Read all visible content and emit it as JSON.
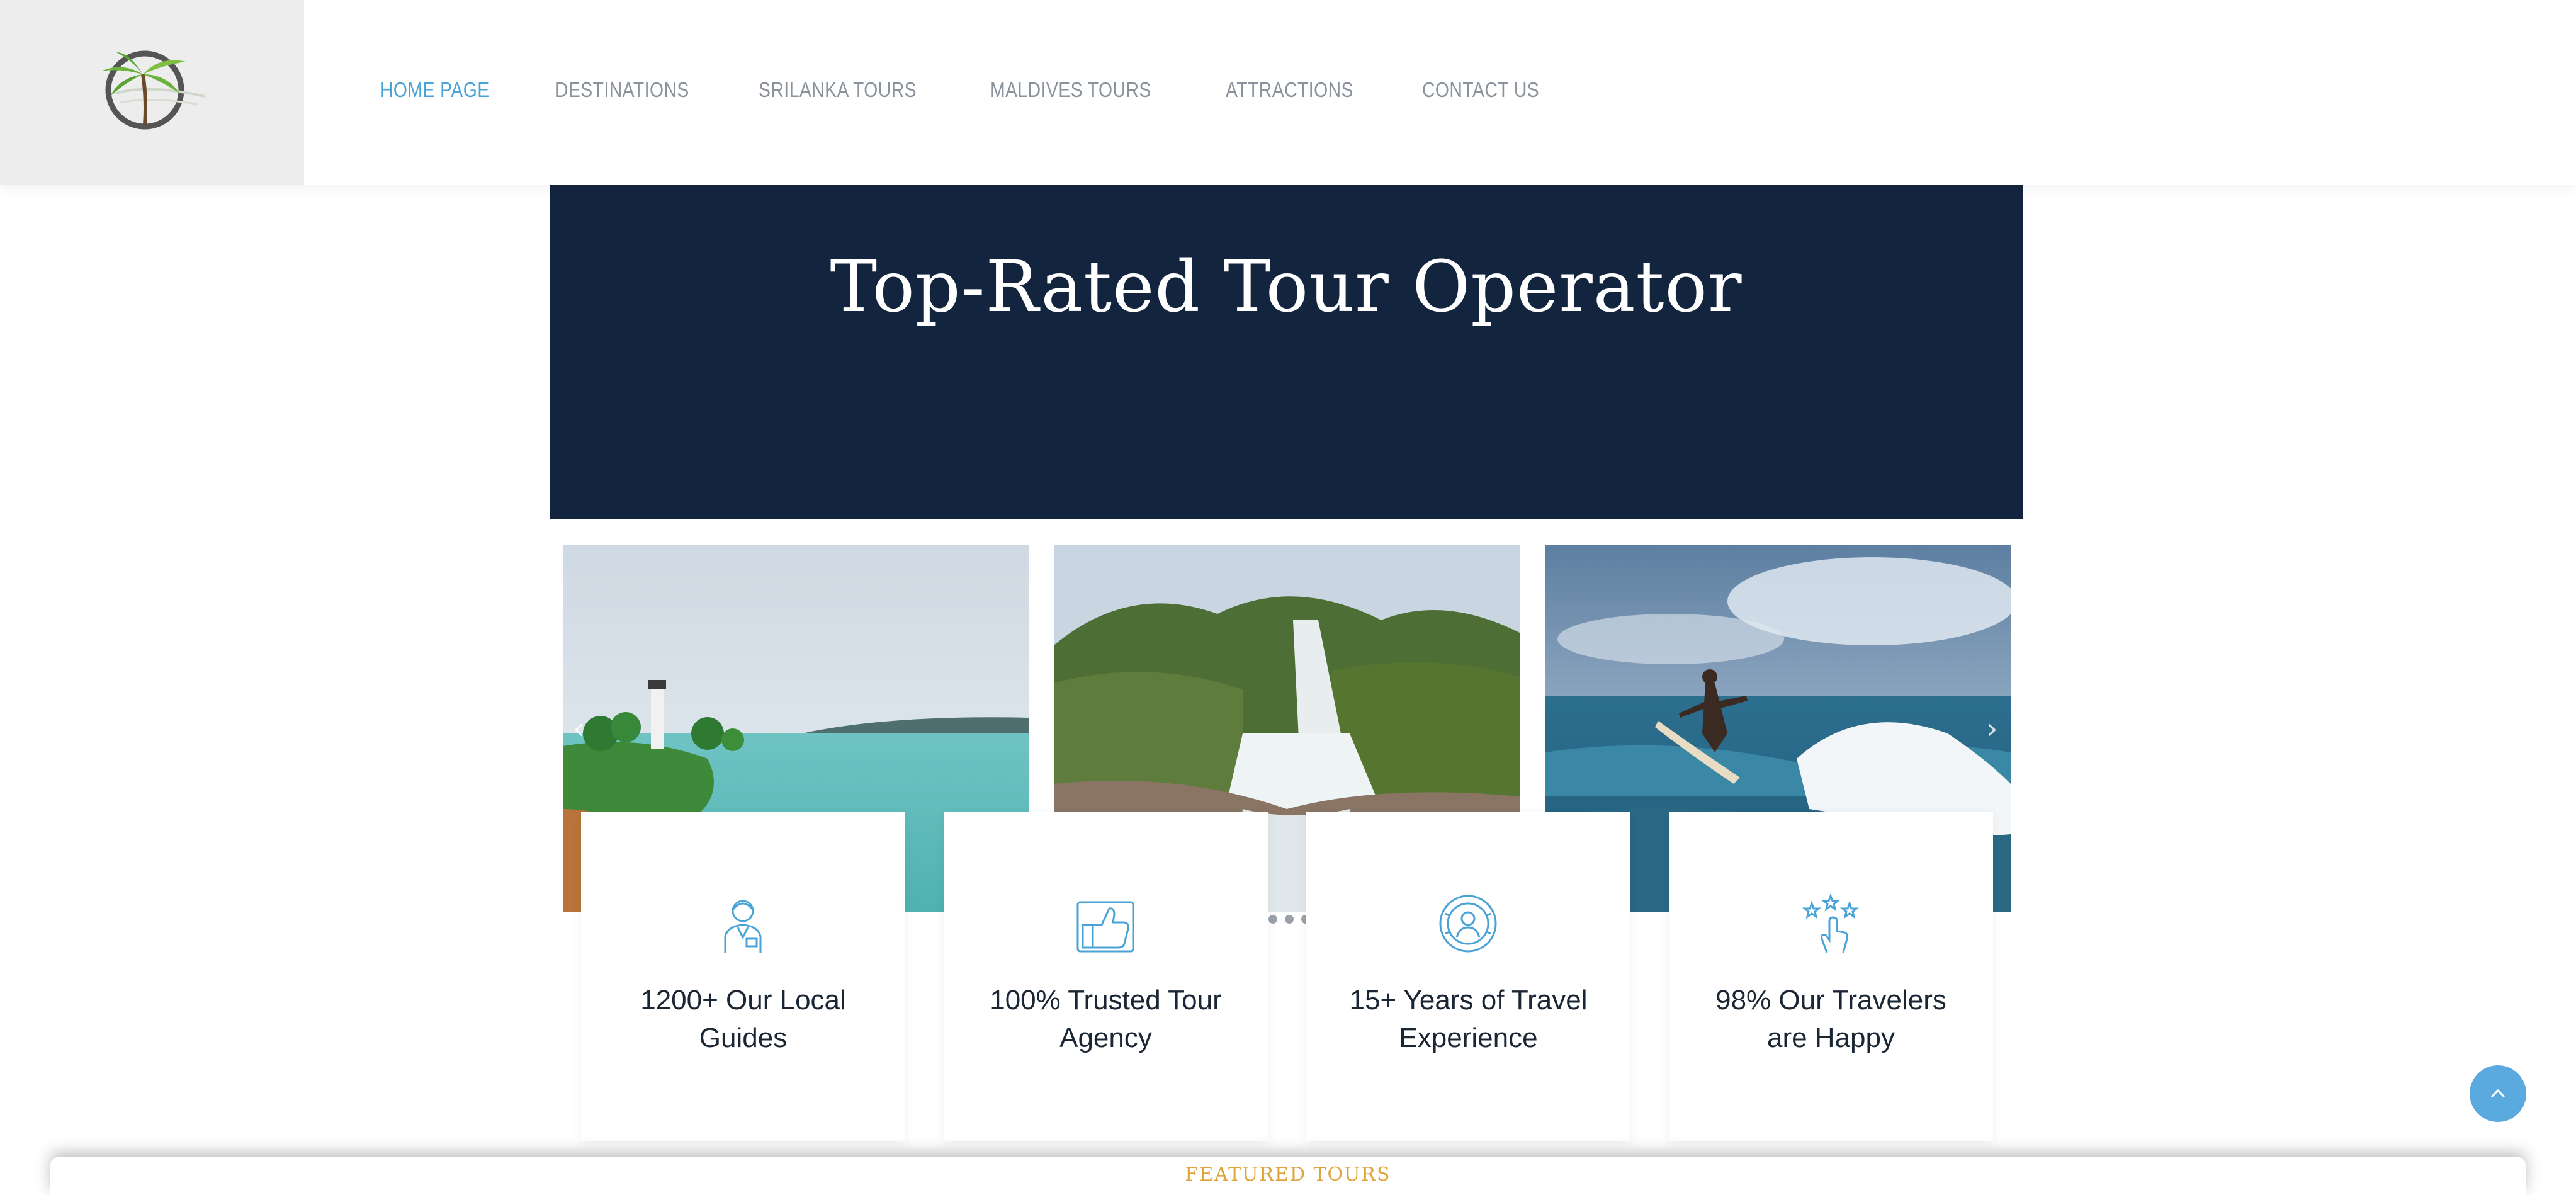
{
  "nav": {
    "items": [
      {
        "label": "HOME PAGE",
        "active": true
      },
      {
        "label": "DESTINATIONS"
      },
      {
        "label": "SRILANKA TOURS"
      },
      {
        "label": "MALDIVES TOURS"
      },
      {
        "label": "ATTRACTIONS"
      },
      {
        "label": "CONTACT US"
      }
    ]
  },
  "hero": {
    "title": "Top-Rated Tour Operator",
    "background": "#13253e"
  },
  "gallery": {
    "photos": [
      "lighthouse-coast-photo",
      "waterfall-photo",
      "surfer-photo"
    ],
    "prev_icon": "chevron-left-icon",
    "next_icon": "chevron-right-icon"
  },
  "features": [
    {
      "icon": "tour-guide-icon",
      "text": "1200+ Our Local Guides"
    },
    {
      "icon": "thumbs-up-icon",
      "text": "100% Trusted Tour Agency"
    },
    {
      "icon": "traveler-badge-icon",
      "text": "15+ Years of Travel Experience"
    },
    {
      "icon": "stars-rating-icon",
      "text": "98% Our Travelers are Happy"
    }
  ],
  "featured_section": {
    "label": "FEATURED TOURS"
  },
  "colors": {
    "accent": "#4aa3d6",
    "hero_bg": "#13253e",
    "nav_text": "#8a929b",
    "featured_label": "#e0a33a"
  }
}
